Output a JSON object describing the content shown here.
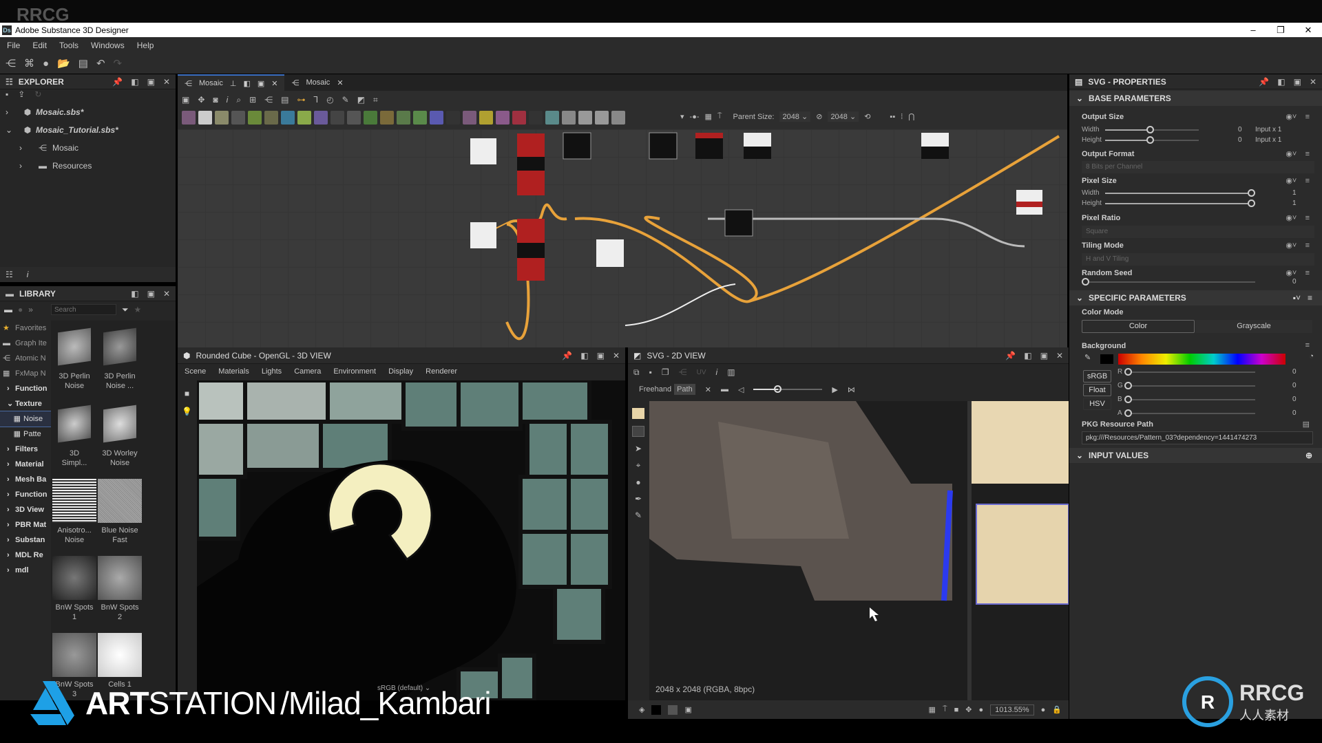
{
  "watermark": "RRCG",
  "window": {
    "title": "Adobe Substance 3D Designer",
    "app_badge": "Ds"
  },
  "menu": [
    "File",
    "Edit",
    "Tools",
    "Windows",
    "Help"
  ],
  "explorer": {
    "title": "EXPLORER",
    "items": [
      {
        "label": "Mosaic.sbs*",
        "italic": true
      },
      {
        "label": "Mosaic_Tutorial.sbs*",
        "italic": true
      },
      {
        "label": "Mosaic"
      },
      {
        "label": "Resources"
      }
    ]
  },
  "library": {
    "title": "LIBRARY",
    "search_placeholder": "Search",
    "tree": [
      "Favorites",
      "Graph Ite",
      "Atomic N",
      "FxMap N",
      "Function",
      "Texture",
      "Noise",
      "Patte",
      "Filters",
      "Material",
      "Mesh Ba",
      "Function",
      "3D View",
      "PBR Mat",
      "Substan",
      "MDL Re",
      "mdl"
    ],
    "items": [
      {
        "l1": "3D Perlin",
        "l2": "Noise"
      },
      {
        "l1": "3D Perlin",
        "l2": "Noise ..."
      },
      {
        "l1": "3D",
        "l2": "Simpl..."
      },
      {
        "l1": "3D Worley",
        "l2": "Noise"
      },
      {
        "l1": "Anisotro...",
        "l2": "Noise"
      },
      {
        "l1": "Blue Noise",
        "l2": "Fast"
      },
      {
        "l1": "BnW Spots",
        "l2": "1"
      },
      {
        "l1": "BnW Spots",
        "l2": "2"
      },
      {
        "l1": "BnW Spots",
        "l2": "3"
      },
      {
        "l1": "Cells 1",
        "l2": ""
      }
    ]
  },
  "graph": {
    "tabs": [
      {
        "label": "Mosaic",
        "active": true
      },
      {
        "label": "Mosaic",
        "active": false
      }
    ],
    "parent_size_label": "Parent Size:",
    "parent_size": "2048",
    "size2": "2048",
    "node_toolbar_colors": [
      "#7a5a7a",
      "#ccc",
      "#8a8a6a",
      "#555",
      "#6a8a3a",
      "#6a6a4a",
      "#3a7a9a",
      "#8aaa4a",
      "#6a5a9a",
      "#444",
      "#555",
      "#4a7a3a",
      "#7a6a3a",
      "#5a7a4a",
      "#5a8a4a",
      "#5a5ab0",
      "#333",
      "#7a5a7a",
      "#b0a030",
      "#8a5a8a",
      "#a03040",
      "#333",
      "#5a8a8a",
      "#888",
      "#999",
      "#999",
      "#888"
    ]
  },
  "view3d": {
    "title": "Rounded Cube - OpenGL - 3D VIEW",
    "menu": [
      "Scene",
      "Materials",
      "Lights",
      "Camera",
      "Environment",
      "Display",
      "Renderer"
    ],
    "colorspace": "sRGB (default)"
  },
  "view2d": {
    "title": "SVG - 2D VIEW",
    "uv_label": "UV",
    "freehand": "Freehand",
    "path": "Path",
    "info": "2048 x 2048 (RGBA, 8bpc)",
    "zoom": "1013.55%"
  },
  "props": {
    "title": "SVG - PROPERTIES",
    "base": "BASE PARAMETERS",
    "output_size": {
      "label": "Output Size",
      "width": "Width",
      "height": "Height",
      "w_val": "0",
      "h_val": "0",
      "w_mode": "Input x 1",
      "h_mode": "Input x 1"
    },
    "output_format": {
      "label": "Output Format",
      "value": "8 Bits per Channel"
    },
    "pixel_size": {
      "label": "Pixel Size",
      "width": "Width",
      "height": "Height",
      "w_val": "1",
      "h_val": "1"
    },
    "pixel_ratio": {
      "label": "Pixel Ratio",
      "value": "Square"
    },
    "tiling_mode": {
      "label": "Tiling Mode",
      "value": "H and V Tiling"
    },
    "random_seed": {
      "label": "Random Seed",
      "value": "0"
    },
    "specific": "SPECIFIC PARAMETERS",
    "color_mode": {
      "label": "Color Mode",
      "options": [
        "Color",
        "Grayscale"
      ],
      "selected": "Color"
    },
    "background": {
      "label": "Background",
      "color": "#000000",
      "buttons": [
        "sRGB",
        "Float",
        "HSV"
      ],
      "channels": [
        {
          "c": "R",
          "v": "0"
        },
        {
          "c": "G",
          "v": "0"
        },
        {
          "c": "B",
          "v": "0"
        },
        {
          "c": "A",
          "v": "0"
        }
      ]
    },
    "pkg": {
      "label": "PKG Resource Path",
      "value": "pkg:///Resources/Pattern_03?dependency=1441474273"
    },
    "input_values": "INPUT VALUES"
  },
  "overlay": {
    "artstation_bold": "ART",
    "artstation_rest": "STATION",
    "handle": "/Milad_Kambari",
    "logo_text": "RRCG",
    "logo_sub": "人人素材"
  }
}
